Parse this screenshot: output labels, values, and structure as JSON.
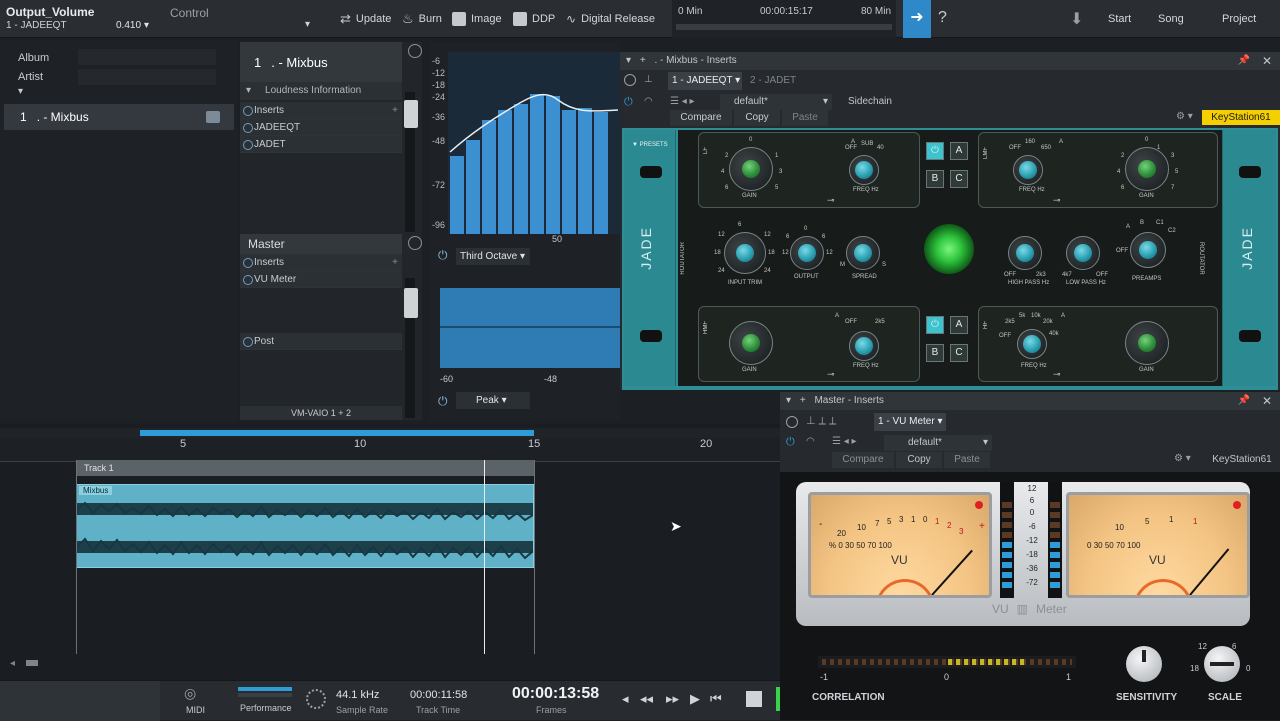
{
  "header": {
    "parameter_name": "Output_Volume",
    "plugin_slot": "1 - JADEEQT",
    "control_label": "Control",
    "value": "0.410",
    "buttons": [
      "Update",
      "Burn",
      "Image",
      "DDP",
      "Digital Release"
    ],
    "time_start": "0 Min",
    "time_current": "00:00:15:17",
    "time_end": "80 Min",
    "help": "?",
    "nav": [
      "Start",
      "Song",
      "Project"
    ]
  },
  "left_panel": {
    "album_label": "Album",
    "artist_label": "Artist",
    "track": {
      "number": "1",
      "name": ". - Mixbus"
    }
  },
  "mixbus_channel": {
    "number": "1",
    "name": ". - Mixbus",
    "loudness": "Loudness Information",
    "inserts_label": "Inserts",
    "inserts": [
      "JADEEQT",
      "JADET"
    ],
    "output": "VM-VAIO 1 + 2"
  },
  "master_channel": {
    "name": "Master",
    "inserts_label": "Inserts",
    "inserts": [
      "VU Meter"
    ],
    "post_label": "Post"
  },
  "spectrum": {
    "db_labels": [
      "-6",
      "-12",
      "-18",
      "-24",
      "-36",
      "-48",
      "-72",
      "-96"
    ],
    "freq_label": "50",
    "mode": "Third Octave",
    "bottom_labels": [
      "-60",
      "-48"
    ],
    "peak_mode": "Peak"
  },
  "mixbus_inserts_window": {
    "title": ". - Mixbus - Inserts",
    "tab_active": "1 - JADEEQT",
    "tab_inactive": "2 - JADET",
    "preset": "default*",
    "sidechain": "Sidechain",
    "compare": "Compare",
    "copy": "Copy",
    "paste": "Paste",
    "keyboard": "KeyStation61"
  },
  "jade_eq": {
    "brand": "JADE",
    "presets": "PRESETS",
    "lf": {
      "band": "LF",
      "gain_label": "GAIN",
      "gain_scale": [
        "0",
        "2",
        "4",
        "6",
        "5",
        "3",
        "1"
      ],
      "freq_label": "FREQ Hz",
      "freq_scale": [
        "OFF",
        "SUB",
        "40"
      ],
      "bell": "A"
    },
    "lmf": {
      "band": "LMF",
      "freq_scale": [
        "OFF",
        "160",
        "650"
      ],
      "freq_label": "FREQ Hz",
      "gain_label": "GAIN",
      "gain_scale": [
        "0",
        "2",
        "4",
        "6",
        "7",
        "5",
        "3",
        "1"
      ],
      "bell": "A"
    },
    "mid": {
      "input_trim": "INPUT TRIM",
      "input_scale": [
        "6",
        "12",
        "18",
        "24",
        "12",
        "18",
        "24"
      ],
      "output": "OUTPUT",
      "output_scale": [
        "0",
        "6",
        "12",
        "12",
        "6"
      ],
      "spread": "SPREAD",
      "spread_scale": [
        "M",
        "S"
      ],
      "high_pass": "HIGH PASS Hz",
      "hp_scale": [
        "OFF",
        "2k3"
      ],
      "low_pass": "LOW PASS Hz",
      "lp_scale": [
        "4k7",
        "OFF"
      ],
      "preamps": "PREAMPS",
      "preamp_scale": [
        "A",
        "B",
        "C1",
        "C2",
        "OFF"
      ],
      "side_label": "ROUTATOR"
    },
    "hmf": {
      "band": "HMF",
      "gain_label": "GAIN",
      "freq_label": "FREQ Hz",
      "freq_scale": [
        "OFF",
        "2k5"
      ],
      "bell": "A"
    },
    "hf": {
      "band": "HF",
      "freq_label": "FREQ Hz",
      "freq_scale": [
        "2k5",
        "5k",
        "10k",
        "20k",
        "40k",
        "OFF"
      ],
      "gain_label": "GAIN",
      "bell": "A"
    },
    "ab_buttons": [
      "A",
      "B",
      "C"
    ]
  },
  "timeline": {
    "ruler": [
      "5",
      "10",
      "15",
      "20"
    ],
    "track_name": "Track 1",
    "clip_name": "Mixbus"
  },
  "master_inserts_window": {
    "title": "Master - Inserts",
    "tab_active": "1 - VU Meter",
    "preset": "default*",
    "compare": "Compare",
    "copy": "Copy",
    "paste": "Paste",
    "keyboard": "KeyStation61"
  },
  "vu_meter": {
    "brand_left": "VU",
    "brand_right": "Meter",
    "meter_label": "VU",
    "scale_top": [
      "20",
      "10",
      "7",
      "5",
      "3",
      "1",
      "0",
      "1",
      "2",
      "3"
    ],
    "scale_bottom": [
      "%",
      "0",
      "30",
      "50",
      "70",
      "100"
    ],
    "plus": "+",
    "minus": "-",
    "db_scale": [
      "12",
      "6",
      "0",
      "-6",
      "-12",
      "-18",
      "-36",
      "-72"
    ],
    "correlation_label": "CORRELATION",
    "correlation_scale": [
      "-1",
      "0",
      "1"
    ],
    "sensitivity_label": "SENSITIVITY",
    "scale_label": "SCALE",
    "scale_knob_values": [
      "12",
      "6",
      "18",
      "0"
    ]
  },
  "transport": {
    "midi": "MIDI",
    "performance": "Performance",
    "sample_rate_value": "44.1 kHz",
    "sample_rate_label": "Sample Rate",
    "track_time_value": "00:00:11:58",
    "track_time_label": "Track Time",
    "frames_value": "00:00:13:58",
    "frames_label": "Frames"
  },
  "colors": {
    "accent": "#2f9cd8",
    "jade_teal": "#2f8e95",
    "clip": "#5fb1c7",
    "highlight": "#f4d000"
  }
}
